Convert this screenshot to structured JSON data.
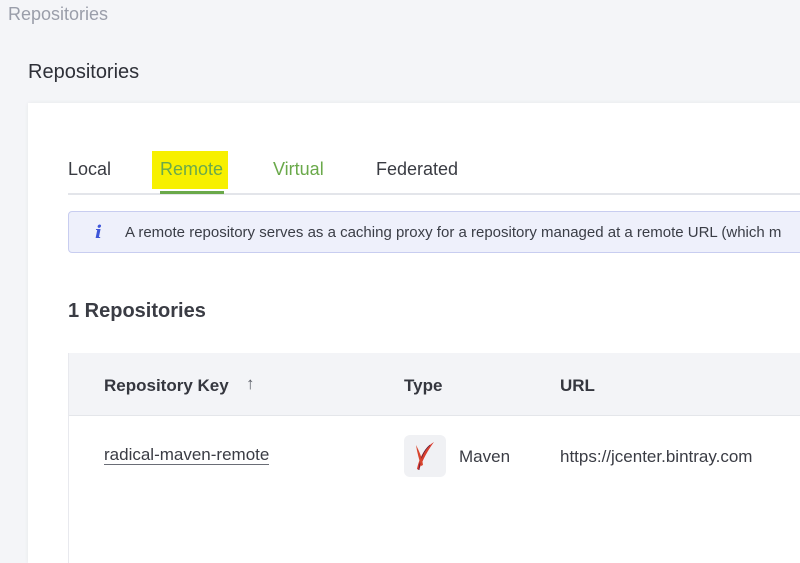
{
  "breadcrumb": "Repositories",
  "page_title": "Repositories",
  "tabs": {
    "local": "Local",
    "remote": "Remote",
    "virtual": "Virtual",
    "federated": "Federated"
  },
  "active_tab": "Remote",
  "info": {
    "icon": "info-icon",
    "glyph": "i",
    "text": "A remote repository serves as a caching proxy for a repository managed at a remote URL (which m"
  },
  "repo_count": "1 Repositories",
  "table": {
    "columns": {
      "key": "Repository Key",
      "type": "Type",
      "url": "URL"
    },
    "sort_icon": "arrow-up-icon",
    "sort_glyph": "↑",
    "rows": [
      {
        "key": "radical-maven-remote",
        "type_icon": "apache-maven-feather-icon",
        "type": "Maven",
        "url": "https://jcenter.bintray.com"
      }
    ]
  },
  "colors": {
    "accent_green": "#6aa94a",
    "highlight_yellow": "#f7f000",
    "info_blue": "#3d55d9"
  }
}
